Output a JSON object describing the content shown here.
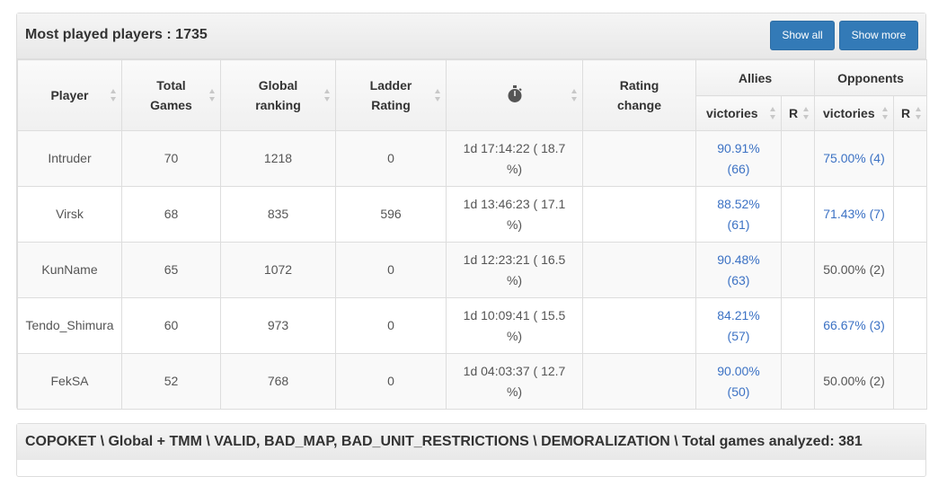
{
  "panel1": {
    "title": "Most played players : 1735",
    "show_all_label": "Show all",
    "show_more_label": "Show more",
    "headers": {
      "player": "Player",
      "total_games": "Total Games",
      "global_ranking": "Global ranking",
      "ladder_rating": "Ladder Rating",
      "time_icon": "stopwatch-icon",
      "rating_change": "Rating change",
      "allies": "Allies",
      "opponents": "Opponents",
      "allies_victories": "victories",
      "allies_r": "R",
      "opponents_victories": "victories",
      "opponents_r": "R"
    },
    "rows": [
      {
        "player": "Intruder",
        "total_games": "70",
        "global_ranking": "1218",
        "ladder_rating": "0",
        "time_line1": "1d 17:14:22 ( 18.7",
        "time_line2": "%)",
        "rating_change": "",
        "allies_line1": "90.91%",
        "allies_line2": "(66)",
        "allies_r": "",
        "opponents": "75.00% (4)",
        "opponents_link": true,
        "opponents_r": ""
      },
      {
        "player": "Virsk",
        "total_games": "68",
        "global_ranking": "835",
        "ladder_rating": "596",
        "time_line1": "1d 13:46:23 ( 17.1",
        "time_line2": "%)",
        "rating_change": "",
        "allies_line1": "88.52%",
        "allies_line2": "(61)",
        "allies_r": "",
        "opponents": "71.43% (7)",
        "opponents_link": true,
        "opponents_r": ""
      },
      {
        "player": "KunName",
        "total_games": "65",
        "global_ranking": "1072",
        "ladder_rating": "0",
        "time_line1": "1d 12:23:21 ( 16.5",
        "time_line2": "%)",
        "rating_change": "",
        "allies_line1": "90.48%",
        "allies_line2": "(63)",
        "allies_r": "",
        "opponents": "50.00% (2)",
        "opponents_link": false,
        "opponents_r": ""
      },
      {
        "player": "Tendo_Shimura",
        "total_games": "60",
        "global_ranking": "973",
        "ladder_rating": "0",
        "time_line1": "1d 10:09:41 ( 15.5",
        "time_line2": "%)",
        "rating_change": "",
        "allies_line1": "84.21%",
        "allies_line2": "(57)",
        "allies_r": "",
        "opponents": "66.67% (3)",
        "opponents_link": true,
        "opponents_r": ""
      },
      {
        "player": "FekSA",
        "total_games": "52",
        "global_ranking": "768",
        "ladder_rating": "0",
        "time_line1": "1d 04:03:37 ( 12.7",
        "time_line2": "%)",
        "rating_change": "",
        "allies_line1": "90.00%",
        "allies_line2": "(50)",
        "allies_r": "",
        "opponents": "50.00% (2)",
        "opponents_link": false,
        "opponents_r": ""
      }
    ]
  },
  "panel2": {
    "title": "COPOKET \\ Global + TMM \\ VALID, BAD_MAP, BAD_UNIT_RESTRICTIONS \\ DEMORALIZATION \\ Total games analyzed: 381"
  },
  "colors": {
    "primary_button": "#337ab7",
    "link": "#3c72c4",
    "border": "#dddddd"
  }
}
